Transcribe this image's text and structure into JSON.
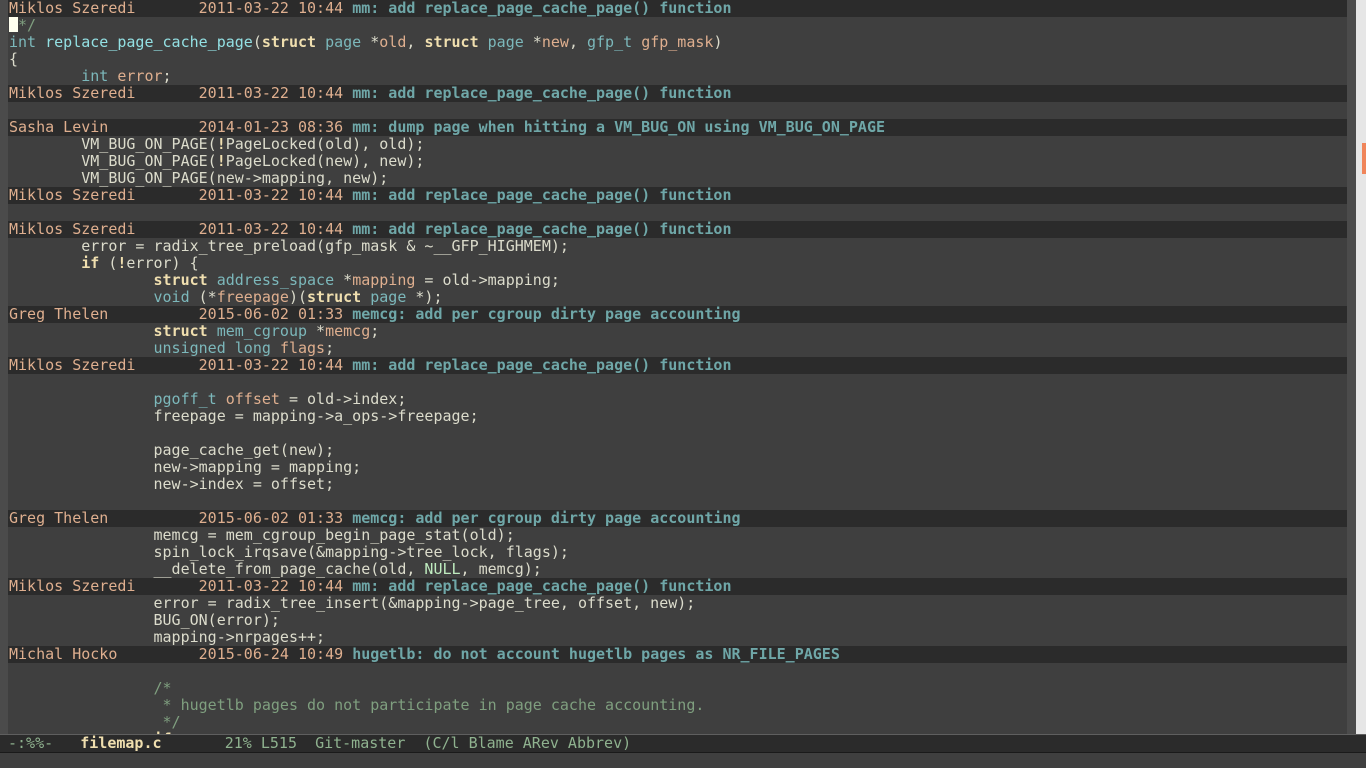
{
  "editor": {
    "lines": [
      {
        "type": "header",
        "author": "Miklos Szeredi",
        "date": "2011-03-22 10:44",
        "summary": "mm: add replace_page_cache_page() function"
      },
      {
        "type": "code",
        "tokens": [
          {
            "c": "cursor",
            "t": ""
          },
          {
            "c": "cm",
            "t": "*/"
          }
        ]
      },
      {
        "type": "code",
        "tokens": [
          {
            "c": "type",
            "t": "int"
          },
          {
            "c": "",
            "t": " "
          },
          {
            "c": "fn",
            "t": "replace_page_cache_page"
          },
          {
            "c": "",
            "t": "("
          },
          {
            "c": "kw",
            "t": "struct"
          },
          {
            "c": "",
            "t": " "
          },
          {
            "c": "type",
            "t": "page"
          },
          {
            "c": "",
            "t": " *"
          },
          {
            "c": "var",
            "t": "old"
          },
          {
            "c": "",
            "t": ", "
          },
          {
            "c": "kw",
            "t": "struct"
          },
          {
            "c": "",
            "t": " "
          },
          {
            "c": "type",
            "t": "page"
          },
          {
            "c": "",
            "t": " *"
          },
          {
            "c": "var",
            "t": "new"
          },
          {
            "c": "",
            "t": ", "
          },
          {
            "c": "type",
            "t": "gfp_t"
          },
          {
            "c": "",
            "t": " "
          },
          {
            "c": "var",
            "t": "gfp_mask"
          },
          {
            "c": "",
            "t": ")"
          }
        ]
      },
      {
        "type": "code",
        "tokens": [
          {
            "c": "",
            "t": "{"
          }
        ]
      },
      {
        "type": "code",
        "tokens": [
          {
            "c": "",
            "t": "        "
          },
          {
            "c": "type",
            "t": "int"
          },
          {
            "c": "",
            "t": " "
          },
          {
            "c": "var",
            "t": "error"
          },
          {
            "c": "",
            "t": ";"
          }
        ]
      },
      {
        "type": "header",
        "author": "Miklos Szeredi",
        "date": "2011-03-22 10:44",
        "summary": "mm: add replace_page_cache_page() function"
      },
      {
        "type": "code",
        "tokens": [
          {
            "c": "",
            "t": ""
          }
        ]
      },
      {
        "type": "header",
        "author": "Sasha Levin",
        "date": "2014-01-23 08:36",
        "summary": "mm: dump page when hitting a VM_BUG_ON using VM_BUG_ON_PAGE"
      },
      {
        "type": "code",
        "tokens": [
          {
            "c": "",
            "t": "        VM_BUG_ON_PAGE("
          },
          {
            "c": "neg",
            "t": "!"
          },
          {
            "c": "",
            "t": "PageLocked(old), old);"
          }
        ]
      },
      {
        "type": "code",
        "tokens": [
          {
            "c": "",
            "t": "        VM_BUG_ON_PAGE("
          },
          {
            "c": "neg",
            "t": "!"
          },
          {
            "c": "",
            "t": "PageLocked(new), new);"
          }
        ]
      },
      {
        "type": "code",
        "tokens": [
          {
            "c": "",
            "t": "        VM_BUG_ON_PAGE(new->mapping, new);"
          }
        ]
      },
      {
        "type": "header",
        "author": "Miklos Szeredi",
        "date": "2011-03-22 10:44",
        "summary": "mm: add replace_page_cache_page() function"
      },
      {
        "type": "code",
        "tokens": [
          {
            "c": "",
            "t": ""
          }
        ]
      },
      {
        "type": "header",
        "author": "Miklos Szeredi",
        "date": "2011-03-22 10:44",
        "summary": "mm: add replace_page_cache_page() function"
      },
      {
        "type": "code",
        "tokens": [
          {
            "c": "",
            "t": "        error = radix_tree_preload(gfp_mask & ~__GFP_HIGHMEM);"
          }
        ]
      },
      {
        "type": "code",
        "tokens": [
          {
            "c": "",
            "t": "        "
          },
          {
            "c": "kw",
            "t": "if"
          },
          {
            "c": "",
            "t": " ("
          },
          {
            "c": "neg",
            "t": "!"
          },
          {
            "c": "",
            "t": "error) {"
          }
        ]
      },
      {
        "type": "code",
        "tokens": [
          {
            "c": "",
            "t": "                "
          },
          {
            "c": "kw",
            "t": "struct"
          },
          {
            "c": "",
            "t": " "
          },
          {
            "c": "type",
            "t": "address_space"
          },
          {
            "c": "",
            "t": " *"
          },
          {
            "c": "var",
            "t": "mapping"
          },
          {
            "c": "",
            "t": " = old->mapping;"
          }
        ]
      },
      {
        "type": "code",
        "tokens": [
          {
            "c": "",
            "t": "                "
          },
          {
            "c": "type",
            "t": "void"
          },
          {
            "c": "",
            "t": " (*"
          },
          {
            "c": "var",
            "t": "freepage"
          },
          {
            "c": "",
            "t": ")("
          },
          {
            "c": "kw",
            "t": "struct"
          },
          {
            "c": "",
            "t": " "
          },
          {
            "c": "type",
            "t": "page"
          },
          {
            "c": "",
            "t": " *);"
          }
        ]
      },
      {
        "type": "header",
        "author": "Greg Thelen",
        "date": "2015-06-02 01:33",
        "summary": "memcg: add per cgroup dirty page accounting"
      },
      {
        "type": "code",
        "tokens": [
          {
            "c": "",
            "t": "                "
          },
          {
            "c": "kw",
            "t": "struct"
          },
          {
            "c": "",
            "t": " "
          },
          {
            "c": "type",
            "t": "mem_cgroup"
          },
          {
            "c": "",
            "t": " *"
          },
          {
            "c": "var",
            "t": "memcg"
          },
          {
            "c": "",
            "t": ";"
          }
        ]
      },
      {
        "type": "code",
        "tokens": [
          {
            "c": "",
            "t": "                "
          },
          {
            "c": "type",
            "t": "unsigned long"
          },
          {
            "c": "",
            "t": " "
          },
          {
            "c": "var",
            "t": "flags"
          },
          {
            "c": "",
            "t": ";"
          }
        ]
      },
      {
        "type": "header",
        "author": "Miklos Szeredi",
        "date": "2011-03-22 10:44",
        "summary": "mm: add replace_page_cache_page() function"
      },
      {
        "type": "code",
        "tokens": [
          {
            "c": "",
            "t": ""
          }
        ]
      },
      {
        "type": "code",
        "tokens": [
          {
            "c": "",
            "t": "                "
          },
          {
            "c": "type",
            "t": "pgoff_t"
          },
          {
            "c": "",
            "t": " "
          },
          {
            "c": "var",
            "t": "offset"
          },
          {
            "c": "",
            "t": " = old->index;"
          }
        ]
      },
      {
        "type": "code",
        "tokens": [
          {
            "c": "",
            "t": "                freepage = mapping->a_ops->freepage;"
          }
        ]
      },
      {
        "type": "code",
        "tokens": [
          {
            "c": "",
            "t": ""
          }
        ]
      },
      {
        "type": "code",
        "tokens": [
          {
            "c": "",
            "t": "                page_cache_get(new);"
          }
        ]
      },
      {
        "type": "code",
        "tokens": [
          {
            "c": "",
            "t": "                new->mapping = mapping;"
          }
        ]
      },
      {
        "type": "code",
        "tokens": [
          {
            "c": "",
            "t": "                new->index = offset;"
          }
        ]
      },
      {
        "type": "code",
        "tokens": [
          {
            "c": "",
            "t": ""
          }
        ]
      },
      {
        "type": "header",
        "author": "Greg Thelen",
        "date": "2015-06-02 01:33",
        "summary": "memcg: add per cgroup dirty page accounting"
      },
      {
        "type": "code",
        "tokens": [
          {
            "c": "",
            "t": "                memcg = mem_cgroup_begin_page_stat(old);"
          }
        ]
      },
      {
        "type": "code",
        "tokens": [
          {
            "c": "",
            "t": "                spin_lock_irqsave(&mapping->tree_lock, flags);"
          }
        ]
      },
      {
        "type": "code",
        "tokens": [
          {
            "c": "",
            "t": "                __delete_from_page_cache(old, "
          },
          {
            "c": "const",
            "t": "NULL"
          },
          {
            "c": "",
            "t": ", memcg);"
          }
        ]
      },
      {
        "type": "header",
        "author": "Miklos Szeredi",
        "date": "2011-03-22 10:44",
        "summary": "mm: add replace_page_cache_page() function"
      },
      {
        "type": "code",
        "tokens": [
          {
            "c": "",
            "t": "                error = radix_tree_insert(&mapping->page_tree, offset, new);"
          }
        ]
      },
      {
        "type": "code",
        "tokens": [
          {
            "c": "",
            "t": "                BUG_ON(error);"
          }
        ]
      },
      {
        "type": "code",
        "tokens": [
          {
            "c": "",
            "t": "                mapping->nrpages++;"
          }
        ]
      },
      {
        "type": "header",
        "author": "Michal Hocko",
        "date": "2015-06-24 10:49",
        "summary": "hugetlb: do not account hugetlb pages as NR_FILE_PAGES"
      },
      {
        "type": "code",
        "tokens": [
          {
            "c": "",
            "t": ""
          }
        ]
      },
      {
        "type": "code",
        "tokens": [
          {
            "c": "",
            "t": "                "
          },
          {
            "c": "cm",
            "t": "/*"
          }
        ]
      },
      {
        "type": "code",
        "tokens": [
          {
            "c": "",
            "t": "                "
          },
          {
            "c": "cm",
            "t": " * hugetlb pages do not participate in page cache accounting."
          }
        ]
      },
      {
        "type": "code",
        "tokens": [
          {
            "c": "",
            "t": "                "
          },
          {
            "c": "cm",
            "t": " */"
          }
        ]
      },
      {
        "type": "code",
        "tokens": [
          {
            "c": "",
            "t": "                "
          },
          {
            "c": "kw",
            "t": "if"
          }
        ]
      }
    ]
  },
  "modeline": {
    "status": "-:%%-",
    "buffer_name": "filemap.c",
    "position_percent": "21%",
    "line_number": "L515",
    "vc": "Git-master",
    "modes": "(C/l Blame ARev Abbrev)"
  },
  "colors": {
    "background": "#3f3f3f",
    "header_background": "#2b2b2b",
    "author": "#dfaf8f",
    "summary": "#6fa7a8",
    "keyword": "#f0dfaf",
    "scroll_marker": "#f0855a"
  }
}
